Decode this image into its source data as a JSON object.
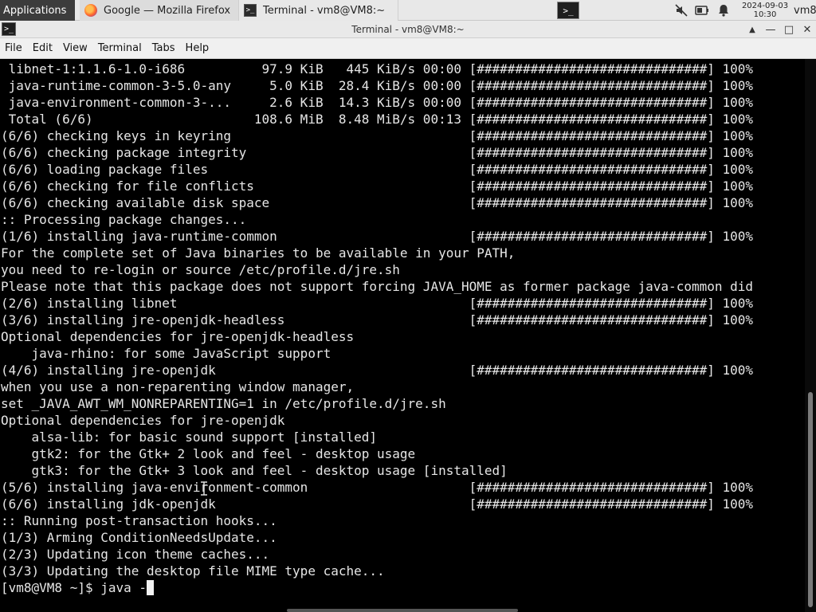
{
  "panel": {
    "apps_label": "Applications",
    "tasks": [
      {
        "label": "Google — Mozilla Firefox",
        "icon": "firefox-icon"
      },
      {
        "label": "Terminal - vm8@VM8:~",
        "icon": "terminal-icon"
      }
    ],
    "launcher_glyph": ">_",
    "tray": [
      "mute-icon",
      "battery-icon",
      "notification-bell-icon"
    ],
    "date": "2024-09-03",
    "time": "10:30",
    "user": "vm8"
  },
  "window": {
    "title": "Terminal - vm8@VM8:~",
    "buttons": [
      "▲",
      "—",
      "□",
      "✕"
    ]
  },
  "menubar": [
    "File",
    "Edit",
    "View",
    "Terminal",
    "Tabs",
    "Help"
  ],
  "terminal": {
    "lines": [
      " libnet-1:1.1.6-1.0-i686          97.9 KiB   445 KiB/s 00:00 [##############################] 100%",
      " java-runtime-common-3-5.0-any     5.0 KiB  28.4 KiB/s 00:00 [##############################] 100%",
      " java-environment-common-3-...     2.6 KiB  14.3 KiB/s 00:00 [##############################] 100%",
      " Total (6/6)                     108.6 MiB  8.48 MiB/s 00:13 [##############################] 100%",
      "(6/6) checking keys in keyring                               [##############################] 100%",
      "(6/6) checking package integrity                             [##############################] 100%",
      "(6/6) loading package files                                  [##############################] 100%",
      "(6/6) checking for file conflicts                            [##############################] 100%",
      "(6/6) checking available disk space                          [##############################] 100%",
      ":: Processing package changes...",
      "(1/6) installing java-runtime-common                         [##############################] 100%",
      "For the complete set of Java binaries to be available in your PATH,",
      "you need to re-login or source /etc/profile.d/jre.sh",
      "Please note that this package does not support forcing JAVA_HOME as former package java-common did",
      "(2/6) installing libnet                                      [##############################] 100%",
      "(3/6) installing jre-openjdk-headless                        [##############################] 100%",
      "Optional dependencies for jre-openjdk-headless",
      "    java-rhino: for some JavaScript support",
      "(4/6) installing jre-openjdk                                 [##############################] 100%",
      "when you use a non-reparenting window manager,",
      "set _JAVA_AWT_WM_NONREPARENTING=1 in /etc/profile.d/jre.sh",
      "Optional dependencies for jre-openjdk",
      "    alsa-lib: for basic sound support [installed]",
      "    gtk2: for the Gtk+ 2 look and feel - desktop usage",
      "    gtk3: for the Gtk+ 3 look and feel - desktop usage [installed]",
      "(5/6) installing java-environment-common                     [##############################] 100%",
      "(6/6) installing jdk-openjdk                                 [##############################] 100%",
      ":: Running post-transaction hooks...",
      "(1/3) Arming ConditionNeedsUpdate...",
      "(2/3) Updating icon theme caches...",
      "(3/3) Updating the desktop file MIME type cache..."
    ],
    "prompt": "[vm8@VM8 ~]$ java -"
  }
}
